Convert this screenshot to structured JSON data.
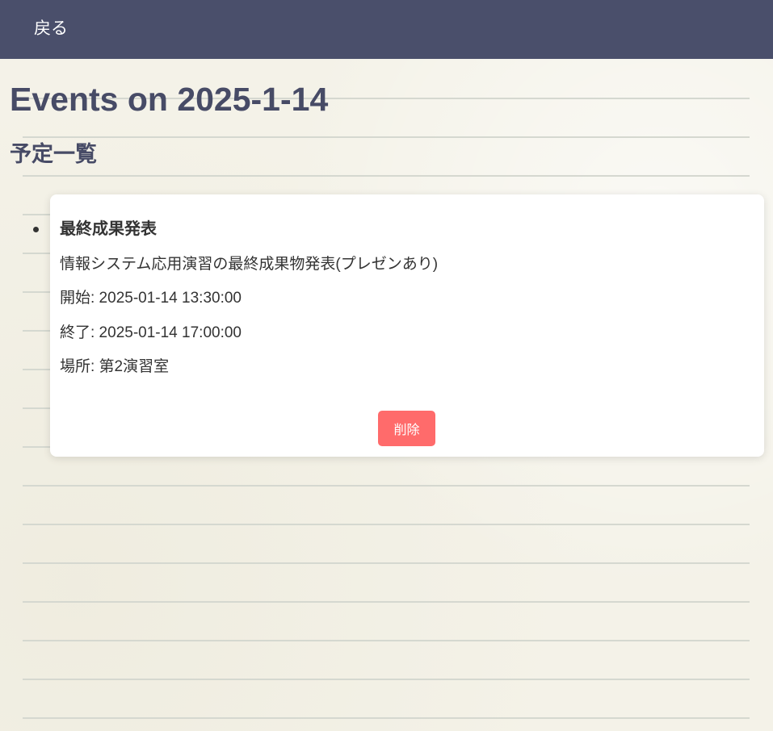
{
  "nav": {
    "back_label": "戻る"
  },
  "page": {
    "title": "Events on 2025-1-14",
    "section_title": "予定一覧"
  },
  "events": [
    {
      "title": "最終成果発表",
      "description": "情報システム応用演習の最終成果物発表(プレゼンあり)",
      "start": "開始: 2025-01-14 13:30:00",
      "end": "終了: 2025-01-14 17:00:00",
      "place": "場所: 第2演習室",
      "delete_label": "削除"
    }
  ],
  "colors": {
    "navbar": "#4a4f6b",
    "heading": "#474b66",
    "delete_button": "#ff6b6b",
    "background": "#f4f2e8",
    "ruled_line": "#d5d8d0"
  }
}
